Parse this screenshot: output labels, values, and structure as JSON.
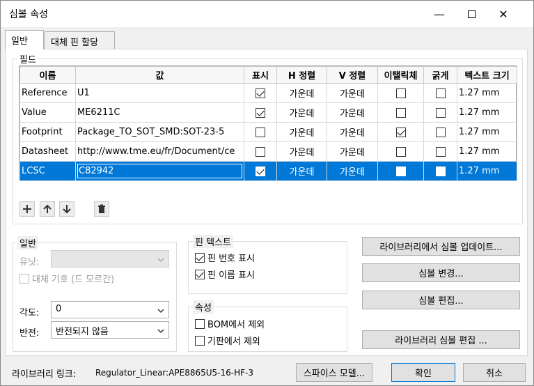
{
  "window": {
    "title": "심볼 속성"
  },
  "tabs": [
    "일반",
    "대체 핀 할당"
  ],
  "fields_group": {
    "label": "필드"
  },
  "table": {
    "headers": [
      "이름",
      "값",
      "표시",
      "H 정렬",
      "V 정렬",
      "이탤릭체",
      "굵게",
      "텍스트 크기"
    ],
    "rows": [
      {
        "name": "Reference",
        "value": "U1",
        "show": true,
        "h_align": "가운데",
        "v_align": "가운데",
        "italic": false,
        "bold": false,
        "size": "1.27 mm"
      },
      {
        "name": "Value",
        "value": "ME6211C",
        "show": true,
        "h_align": "가운데",
        "v_align": "가운데",
        "italic": false,
        "bold": false,
        "size": "1.27 mm"
      },
      {
        "name": "Footprint",
        "value": "Package_TO_SOT_SMD:SOT-23-5",
        "show": false,
        "h_align": "가운데",
        "v_align": "가운데",
        "italic": true,
        "bold": false,
        "size": "1.27 mm"
      },
      {
        "name": "Datasheet",
        "value": "http://www.tme.eu/fr/Document/ce",
        "show": false,
        "h_align": "가운데",
        "v_align": "가운데",
        "italic": false,
        "bold": false,
        "size": "1.27 mm"
      },
      {
        "name": "LCSC",
        "value": "C82942",
        "show": true,
        "h_align": "가운데",
        "v_align": "가운데",
        "italic": false,
        "bold": false,
        "size": "1.27 mm"
      }
    ],
    "selected_row": 4
  },
  "general_group": {
    "label": "일반",
    "unit_label": "유닛:",
    "unit_value": "",
    "alt_symbol_label": "대체 기호 (드 모르간)",
    "angle_label": "각도:",
    "angle_value": "0",
    "mirror_label": "반전:",
    "mirror_value": "반전되지 않음"
  },
  "pin_text_group": {
    "label": "핀 텍스트",
    "show_pin_numbers": "핀 번호 표시",
    "show_pin_names": "핀 이름 표시"
  },
  "attributes_group": {
    "label": "속성",
    "exclude_bom": "BOM에서 제외",
    "exclude_board": "기판에서 제외"
  },
  "right_buttons": {
    "update_from_library": "라이브러리에서 심볼 업데이트...",
    "change_symbol": "심볼 변경...",
    "edit_symbol": "심볼 편집...",
    "edit_library_symbol": "라이브러리 심볼 편집 ..."
  },
  "footer": {
    "library_link_label": "라이브러리 링크:",
    "library_link_value": "Regulator_Linear:APE8865U5-16-HF-3",
    "spice_button": "스파이스 모델...",
    "ok_button": "확인",
    "cancel_button": "취소"
  }
}
